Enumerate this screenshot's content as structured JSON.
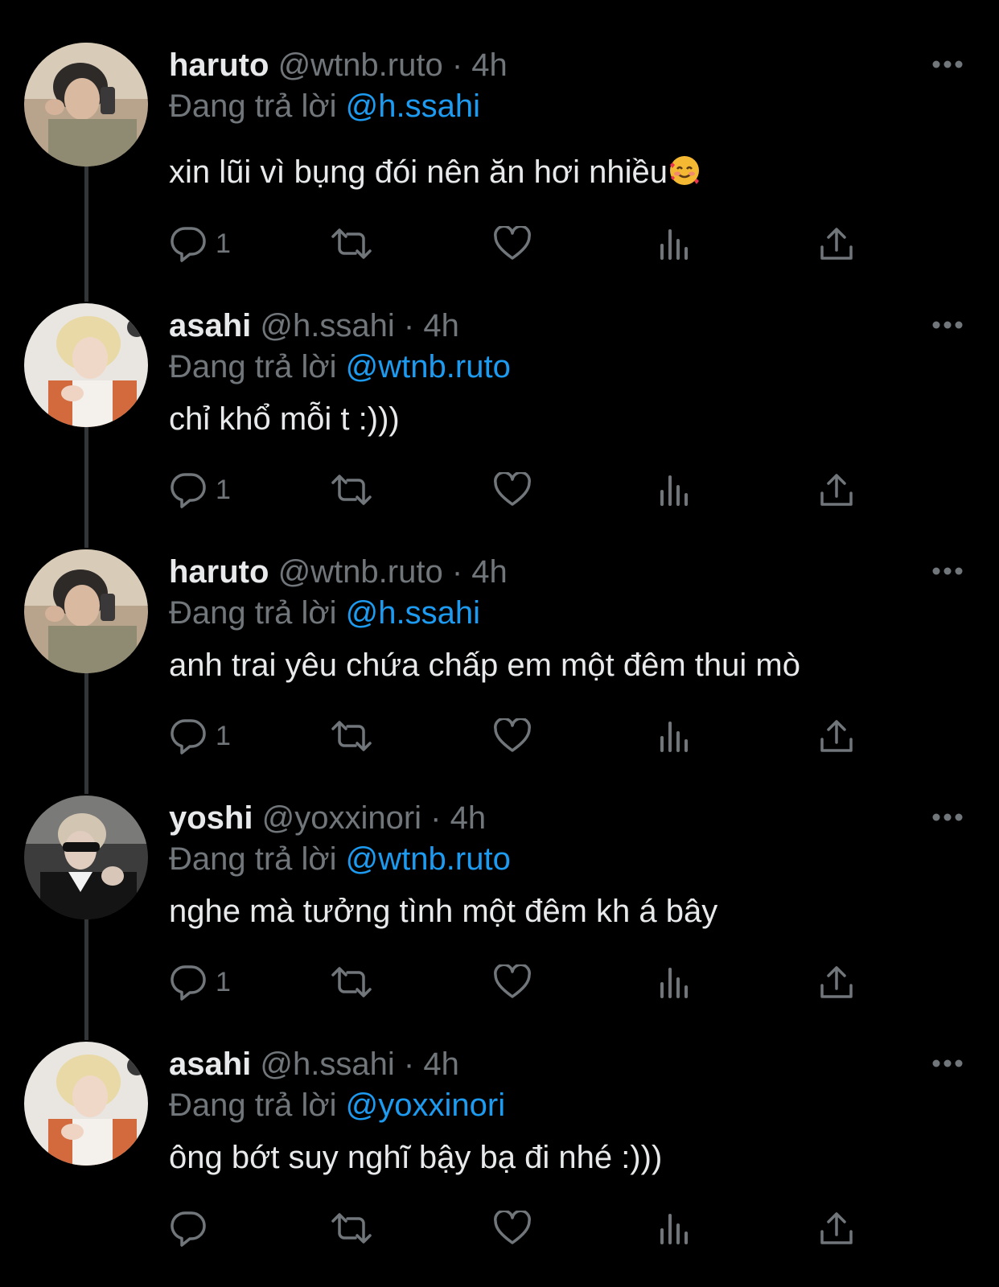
{
  "tweets": [
    {
      "name": "haruto",
      "handle": "@wtnb.ruto",
      "sep": "·",
      "time": "4h",
      "reply_prefix": "Đang trả lời",
      "reply_to": "@h.ssahi",
      "text": "xin lũi vì bụng đói nên ăn hơi nhiều",
      "emoji": "smiling-face-with-hearts",
      "reply_count": "1",
      "avatar": "haruto"
    },
    {
      "name": "asahi",
      "handle": "@h.ssahi",
      "sep": "·",
      "time": "4h",
      "reply_prefix": "Đang trả lời",
      "reply_to": "@wtnb.ruto",
      "text": "chỉ khổ mỗi t :)))",
      "reply_count": "1",
      "avatar": "asahi"
    },
    {
      "name": "haruto",
      "handle": "@wtnb.ruto",
      "sep": "·",
      "time": "4h",
      "reply_prefix": "Đang trả lời",
      "reply_to": "@h.ssahi",
      "text": "anh trai yêu chứa chấp em một đêm thui mò",
      "reply_count": "1",
      "avatar": "haruto"
    },
    {
      "name": "yoshi",
      "handle": "@yoxxinori",
      "sep": "·",
      "time": "4h",
      "reply_prefix": "Đang trả lời",
      "reply_to": "@wtnb.ruto",
      "text": "nghe mà tưởng tình một đêm kh á bây",
      "reply_count": "1",
      "avatar": "yoshi"
    },
    {
      "name": "asahi",
      "handle": "@h.ssahi",
      "sep": "·",
      "time": "4h",
      "reply_prefix": "Đang trả lời",
      "reply_to": "@yoxxinori",
      "text": "ông bớt suy nghĩ bậy bạ đi nhé :)))",
      "reply_count": "",
      "avatar": "asahi"
    }
  ],
  "icons": {
    "reply": "reply-icon",
    "retweet": "retweet-icon",
    "like": "heart-icon",
    "views": "analytics-icon",
    "share": "share-icon",
    "more": "more-icon"
  },
  "colors": {
    "background": "#000000",
    "text": "#e7e9ea",
    "muted": "#71767b",
    "link": "#1d9bf0",
    "thread": "#333639"
  }
}
